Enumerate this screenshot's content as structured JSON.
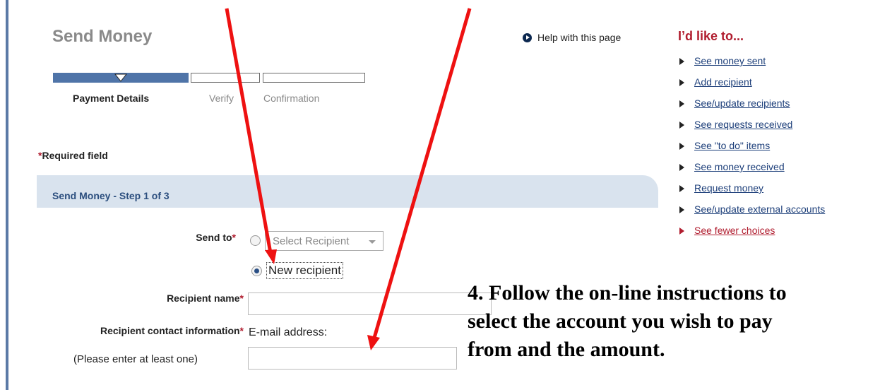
{
  "page": {
    "title": "Send Money",
    "help_link": "Help with this page"
  },
  "progress": {
    "steps": [
      {
        "label": "Payment Details",
        "active": true
      },
      {
        "label": "Verify",
        "active": false
      },
      {
        "label": "Confirmation",
        "active": false
      }
    ]
  },
  "form": {
    "required_note": {
      "star": "*",
      "text": "Required field"
    },
    "section_title": "Send Money - Step 1 of 3",
    "send_to": {
      "label": "Send to",
      "star": "*"
    },
    "select_recipient": {
      "value": "Select Recipient",
      "selected": false
    },
    "new_recipient": {
      "label": "New recipient",
      "selected": true
    },
    "recipient_name": {
      "label": "Recipient name",
      "star": "*",
      "value": ""
    },
    "contact_info": {
      "label": "Recipient contact information",
      "star": "*"
    },
    "email": {
      "label": "E-mail address:",
      "value": ""
    },
    "hint": "(Please enter at least one)"
  },
  "sidebar": {
    "title": "I’d like to...",
    "items": [
      "See money sent",
      "Add recipient",
      "See/update recipients",
      "See requests received",
      "See \"to do\" items",
      "See money received",
      "Request money",
      "See/update external accounts"
    ],
    "fewer": "See fewer choices"
  },
  "annotation": {
    "text": "4. Follow the on-line instructions to select the account you wish to pay from and the amount.",
    "arrow_color": "#ee1111"
  },
  "colors": {
    "accent_red": "#b01c2e",
    "link_blue": "#1d3f7a",
    "progress_blue": "#4f74a8",
    "band": "#d9e3ee"
  }
}
